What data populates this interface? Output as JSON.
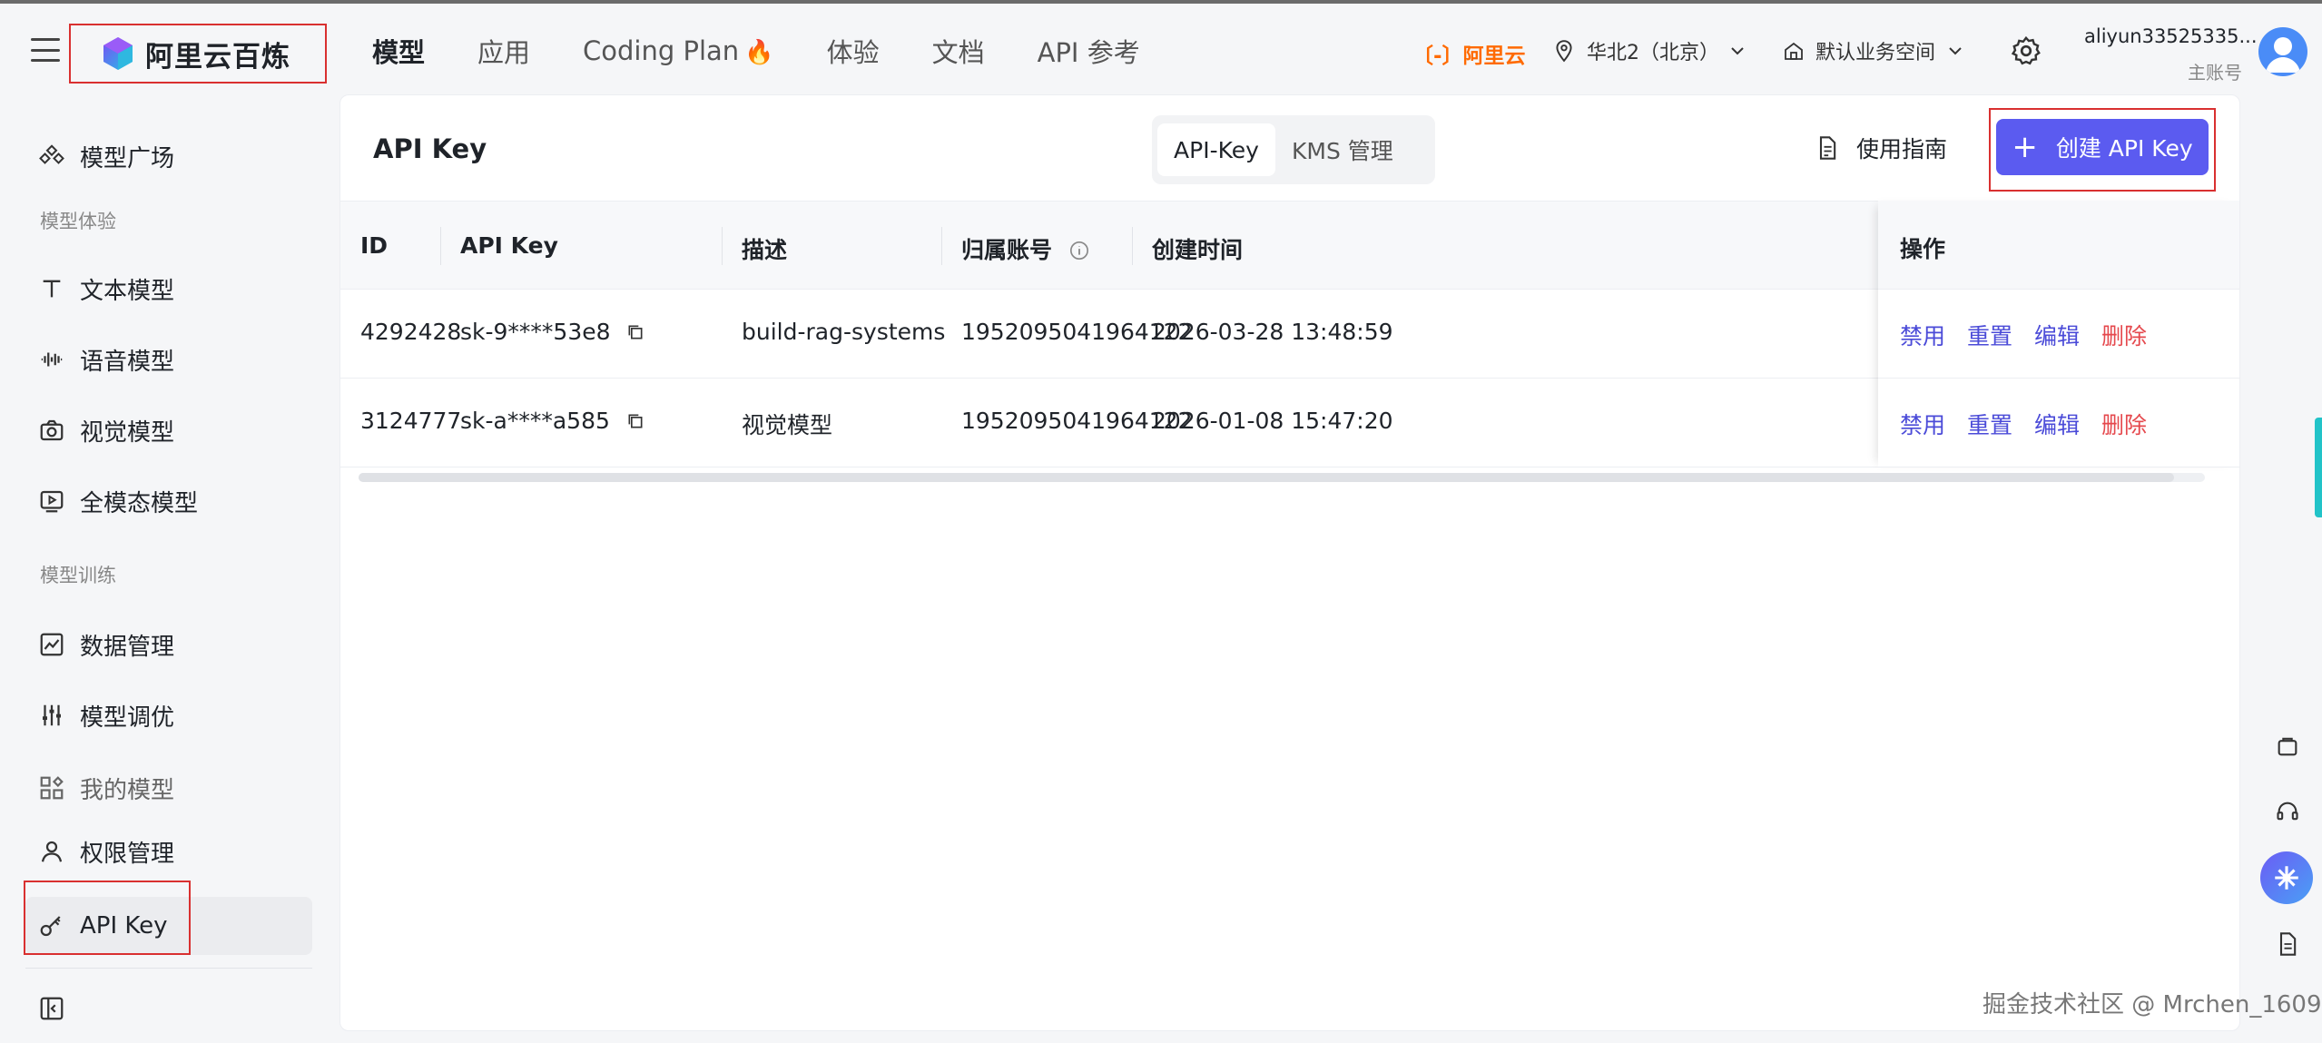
{
  "header": {
    "logo_text": "阿里云百炼",
    "nav": [
      "模型",
      "应用",
      "Coding Plan",
      "体验",
      "文档",
      "API 参考"
    ],
    "coding_plan_badge": "🔥",
    "brand": "〔-〕阿里云",
    "region": "华北2（北京）",
    "workspace": "默认业务空间",
    "user_name": "aliyun33525335...",
    "user_role": "主账号"
  },
  "sidebar": {
    "items": [
      {
        "label": "模型广场",
        "icon": "model-plaza-icon"
      },
      {
        "label": "文本模型",
        "icon": "text-model-icon"
      },
      {
        "label": "语音模型",
        "icon": "audio-model-icon"
      },
      {
        "label": "视觉模型",
        "icon": "camera-icon"
      },
      {
        "label": "全模态模型",
        "icon": "omni-model-icon"
      },
      {
        "label": "数据管理",
        "icon": "chart-icon"
      },
      {
        "label": "模型调优",
        "icon": "sliders-icon"
      },
      {
        "label": "我的模型",
        "icon": "grid-icon"
      },
      {
        "label": "权限管理",
        "icon": "user-icon"
      },
      {
        "label": "API Key",
        "icon": "key-icon"
      }
    ],
    "groups": [
      "模型体验",
      "模型训练"
    ]
  },
  "page": {
    "title": "API Key",
    "tabs": [
      "API-Key",
      "KMS 管理"
    ],
    "guide": "使用指南",
    "create_button": "创建 API Key"
  },
  "table": {
    "columns": [
      "ID",
      "API Key",
      "描述",
      "归属账号",
      "创建时间",
      "操作"
    ],
    "rows": [
      {
        "id": "4292428",
        "key": "sk-9****53e8",
        "desc": "build-rag-systems",
        "account": "1952095041964122",
        "created": "2026-03-28 13:48:59"
      },
      {
        "id": "3124777",
        "key": "sk-a****a585",
        "desc": "视觉模型",
        "account": "1952095041964122",
        "created": "2026-01-08 15:47:20"
      }
    ],
    "actions": [
      "禁用",
      "重置",
      "编辑",
      "删除"
    ]
  },
  "watermark": "掘金技术社区 @ Mrchen_1609",
  "colors": {
    "accent": "#5b5bf0",
    "danger": "#e5484d",
    "link": "#4b4bd8",
    "brand_orange": "#ff6a00",
    "highlight_box": "#d93030"
  }
}
